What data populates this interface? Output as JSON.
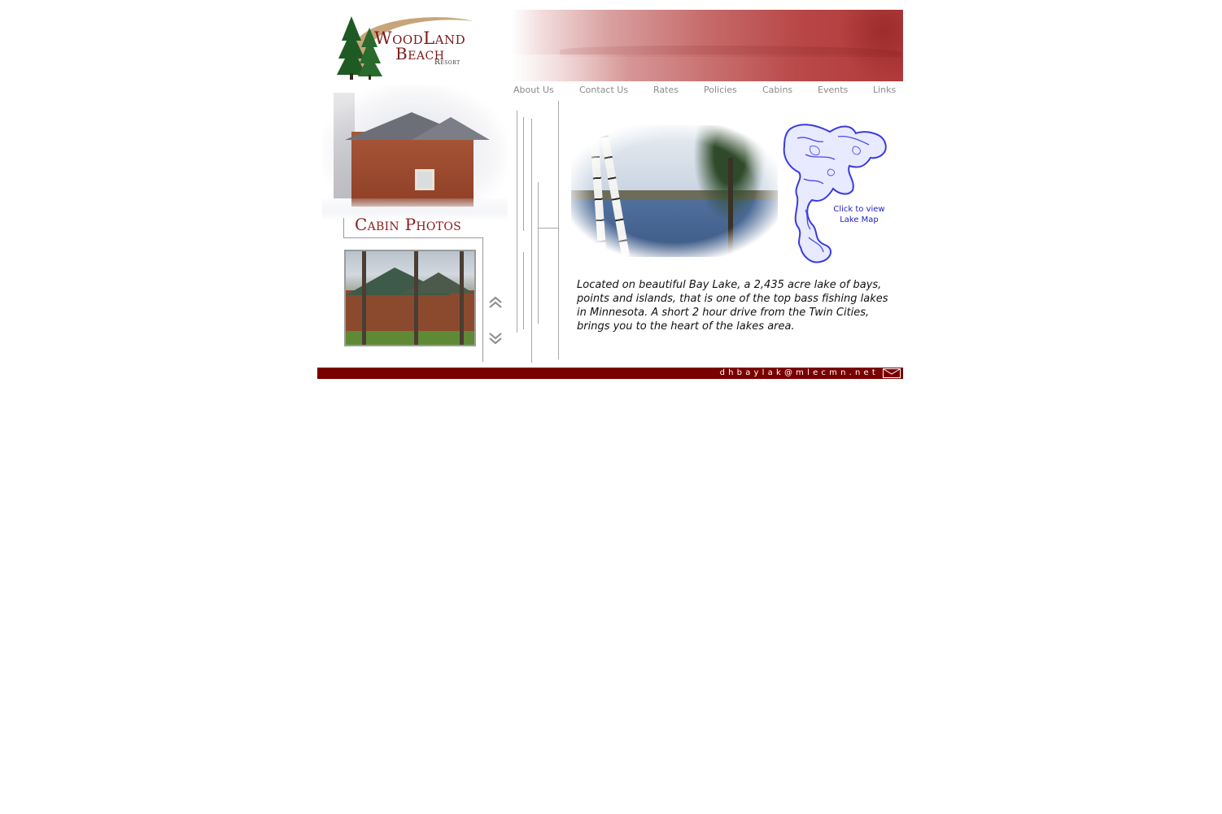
{
  "logo": {
    "line1": "WoodLand",
    "line2": "Beach",
    "line3": "Resort"
  },
  "nav": {
    "items": [
      {
        "label": "About Us"
      },
      {
        "label": "Contact Us"
      },
      {
        "label": "Rates"
      },
      {
        "label": "Policies"
      },
      {
        "label": "Cabins"
      },
      {
        "label": "Events"
      },
      {
        "label": "Links"
      }
    ]
  },
  "cabin_photos": {
    "heading": "Cabin Photos",
    "up_icon": "double-chevron-up-icon",
    "down_icon": "double-chevron-down-icon"
  },
  "lake_map": {
    "caption_line1": "Click to view",
    "caption_line2": "Lake Map"
  },
  "description": "Located on beautiful Bay Lake, a 2,435 acre lake of bays, points and islands, that is one of the top bass fishing lakes in Minnesota. A short 2 hour drive from the Twin Cities, brings you to the heart of the lakes area.",
  "footer": {
    "email": "dhbaylak@mlecmn.net",
    "mail_icon": "envelope-icon"
  },
  "colors": {
    "brand_red": "#8b1a1a",
    "footer_bar": "#7a0000",
    "nav_text": "#8a8a8a",
    "map_blue": "#2020c8"
  }
}
